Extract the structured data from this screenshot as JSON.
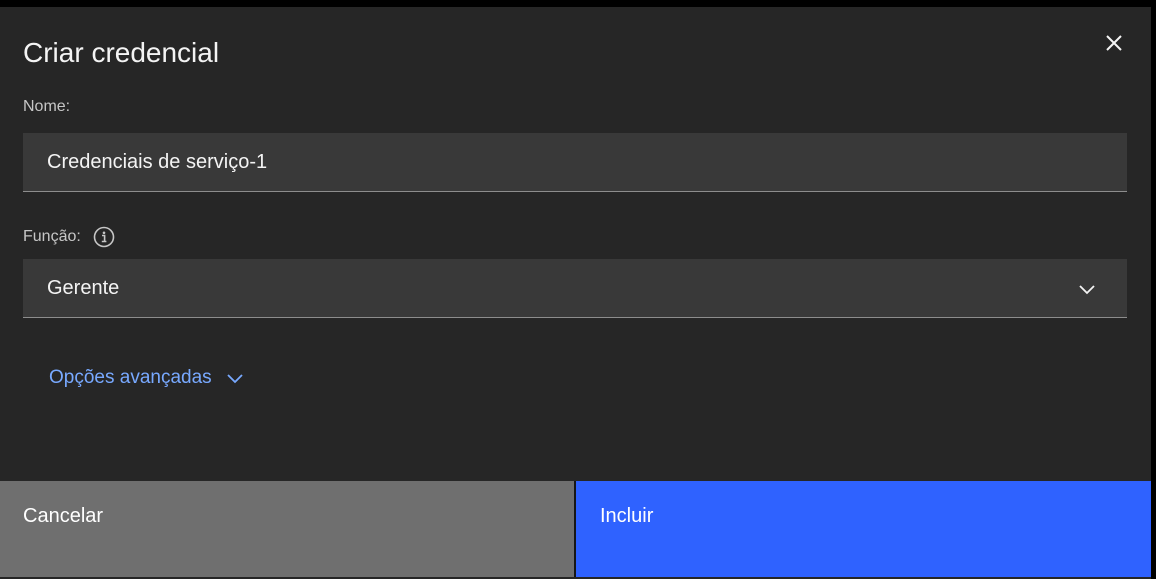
{
  "modal": {
    "title": "Criar credencial",
    "close_icon": "close-icon"
  },
  "name_field": {
    "label": "Nome:",
    "value": "Credenciais de serviço-1"
  },
  "role_field": {
    "label": "Função:",
    "info_icon": "info-icon",
    "selected": "Gerente",
    "chevron_icon": "chevron-down-icon"
  },
  "advanced": {
    "label": "Opções avançadas",
    "icon": "chevron-down-icon"
  },
  "footer": {
    "cancel_label": "Cancelar",
    "submit_label": "Incluir"
  },
  "colors": {
    "modal_bg": "#262626",
    "field_bg": "#393939",
    "link": "#78a9ff",
    "primary": "#2f62ff",
    "secondary": "#6f6f6f"
  }
}
